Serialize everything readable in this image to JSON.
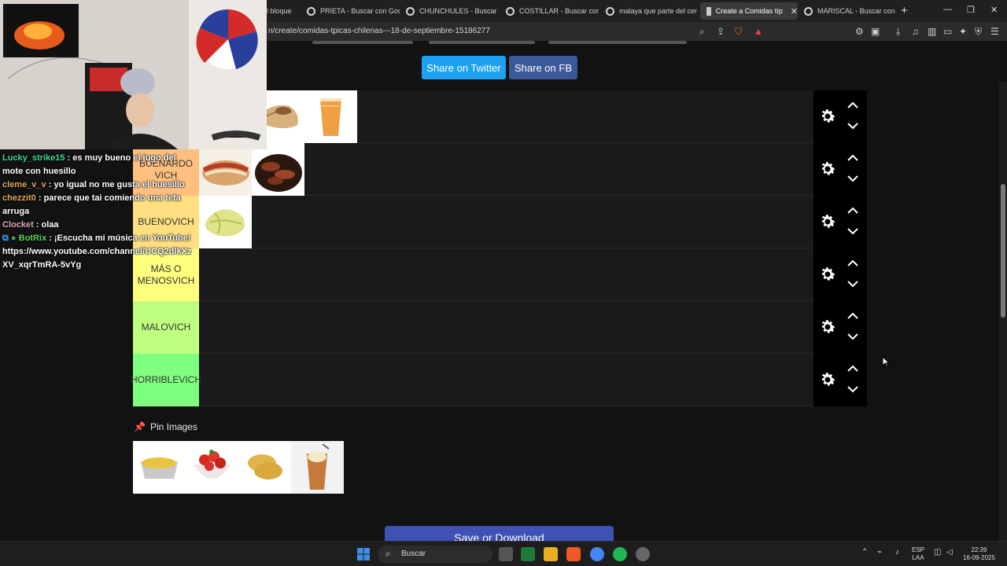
{
  "browser": {
    "tabs": [
      {
        "label": "l bloque",
        "active": false
      },
      {
        "label": "PRIETA - Buscar con Goog",
        "active": false
      },
      {
        "label": "CHUNCHULES - Buscar co",
        "active": false
      },
      {
        "label": "COSTILLAR - Buscar con G",
        "active": false
      },
      {
        "label": "malaya que parte del cer",
        "active": false
      },
      {
        "label": "Create a Comidas típ",
        "active": true
      },
      {
        "label": "MARISCAL - Buscar con G",
        "active": false
      }
    ],
    "url": "n/create/comidas-tpicas-chilenas---18-de-septiembre-15186277"
  },
  "page": {
    "share_twitter": "Share on Twitter",
    "share_fb": "Share on FB",
    "tiers": [
      {
        "label": "",
        "color": "#ff7f7f",
        "items": [
          "grilled-meat-image",
          "empanada-image",
          "orange-drink-image"
        ]
      },
      {
        "label": "BUENARDO VICH",
        "color": "#ffbf7f",
        "items": [
          "sandwich-image",
          "sausage-pot-image"
        ]
      },
      {
        "label": "BUENOVICH",
        "color": "#ffdf7f",
        "items": [
          "humita-image"
        ]
      },
      {
        "label": "MÁS O MENOSVICH",
        "color": "#ffff7f",
        "items": []
      },
      {
        "label": "MALOVICH",
        "color": "#bfff7f",
        "items": []
      },
      {
        "label": "HORRIBLEVICH",
        "color": "#7fff7f",
        "items": []
      }
    ],
    "pin_title": "Pin Images",
    "pin_images": [
      "pastel-de-choclo-image",
      "tomato-salad-image",
      "sopaipilla-image",
      "mote-con-huesillo-image"
    ],
    "save_button": "Save or Download"
  },
  "chat": [
    {
      "user": "Lucky_strike15",
      "user_color": "#3ddc97",
      "text": ": es muy bueno el jugo del mote con huesillo"
    },
    {
      "user": "cleme_v_v",
      "user_color": "#e3a857",
      "text": ": yo igual no me gusta el huesillo"
    },
    {
      "user": "chezzit0",
      "user_color": "#e3a857",
      "text": ": parece que tai comiendo una teta arruga"
    },
    {
      "user": "Clocket",
      "user_color": "#e6a6c8",
      "text": ": olaa"
    },
    {
      "user": "BotRix",
      "user_color": "#5dd35d",
      "text": ": ¡Escucha mi música en YouTube! https://www.youtube.com/channel/UCQ2dlkXzXV_xqrTmRA-5vYg"
    }
  ],
  "taskbar": {
    "search_placeholder": "Buscar",
    "lang_line1": "ESP",
    "lang_line2": "LAA",
    "time": "22:39",
    "date": "16-09-2025"
  }
}
